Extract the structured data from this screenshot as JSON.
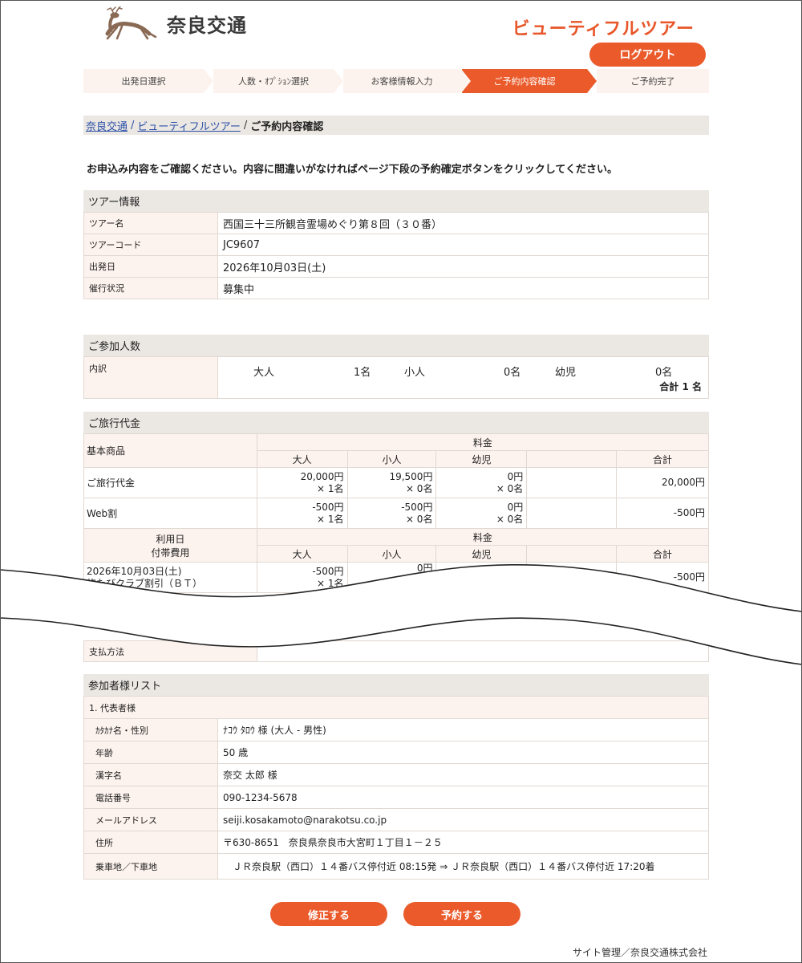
{
  "header": {
    "logo_text": "奈良交通",
    "brand": "ビューティフルツアー",
    "logout_label": "ログアウト"
  },
  "steps": [
    {
      "label": "出発日選択",
      "active": false
    },
    {
      "label": "人数・ｵﾌﾟｼｮﾝ選択",
      "active": false
    },
    {
      "label": "お客様情報入力",
      "active": false
    },
    {
      "label": "ご予約内容確認",
      "active": true
    },
    {
      "label": "ご予約完了",
      "active": false
    }
  ],
  "breadcrumb": {
    "link1": "奈良交通",
    "link2": "ビューティフルツアー",
    "current": "ご予約内容確認",
    "sep": "/"
  },
  "notice": "お申込み内容をご確認ください。内容に間違いがなければページ下段の予約確定ボタンをクリックしてください。",
  "tour": {
    "title": "ツアー情報",
    "rows": [
      {
        "label": "ツアー名",
        "value": "西国三十三所観音霊場めぐり第８回（３０番）"
      },
      {
        "label": "ツアーコード",
        "value": "JC9607"
      },
      {
        "label": "出発日",
        "value": "2026年10月03日(土)"
      },
      {
        "label": "催行状況",
        "value": "募集中"
      }
    ]
  },
  "participants": {
    "title": "ご参加人数",
    "label": "内訳",
    "adult_label": "大人",
    "adult_count": "1名",
    "child_label": "小人",
    "child_count": "0名",
    "infant_label": "幼児",
    "infant_count": "0名",
    "total": "合計 1 名"
  },
  "price": {
    "title": "ご旅行代金",
    "base_label": "基本商品",
    "fee_label": "料金",
    "col_adult": "大人",
    "col_child": "小人",
    "col_infant": "幼児",
    "col_total": "合計",
    "rows": [
      {
        "label": "ご旅行代金",
        "adult": "20,000円",
        "adult_n": "× 1名",
        "child": "19,500円",
        "child_n": "× 0名",
        "infant": "0円",
        "infant_n": "× 0名",
        "total": "20,000円"
      },
      {
        "label": "Web割",
        "adult": "-500円",
        "adult_n": "× 1名",
        "child": "-500円",
        "child_n": "× 0名",
        "infant": "0円",
        "infant_n": "× 0名",
        "total": "-500円"
      }
    ],
    "opt_label1": "利用日",
    "opt_label2": "付帯費用",
    "opt_row": {
      "date": "2026年10月03日(土)",
      "name": "旅たびクラブ割引（ＢＴ）",
      "adult": "-500円",
      "adult_n": "× 1名",
      "child": "0円",
      "total": "-500円"
    },
    "pay_label": "支払方法"
  },
  "plist": {
    "title": "参加者様リスト",
    "sub": "1. 代表者様",
    "rows": [
      {
        "label": "ｶﾀｶﾅ名・性別",
        "value": "ﾅｺｳ ﾀﾛｳ 様 (大人 - 男性)"
      },
      {
        "label": "年齢",
        "value": "50 歳"
      },
      {
        "label": "漢字名",
        "value": "奈交 太郎 様"
      },
      {
        "label": "電話番号",
        "value": "090-1234-5678"
      },
      {
        "label": "メールアドレス",
        "value": "seiji.kosakamoto@narakotsu.co.jp"
      },
      {
        "label": "住所",
        "value": "〒630-8651　奈良県奈良市大宮町１丁目１－２５"
      },
      {
        "label": "乗車地／下車地",
        "value": "　ＪＲ奈良駅（西口）１４番バス停付近 08:15発 ⇒ ＪＲ奈良駅（西口）１４番バス停付近 17:20着"
      }
    ]
  },
  "buttons": {
    "edit": "修正する",
    "reserve": "予約する"
  },
  "footer": "サイト管理／奈良交通株式会社",
  "colors": {
    "accent": "#ea5a2a",
    "label_bg": "#fdf3ee",
    "section_bg": "#ebe8e3",
    "link": "#2b4fa8"
  }
}
